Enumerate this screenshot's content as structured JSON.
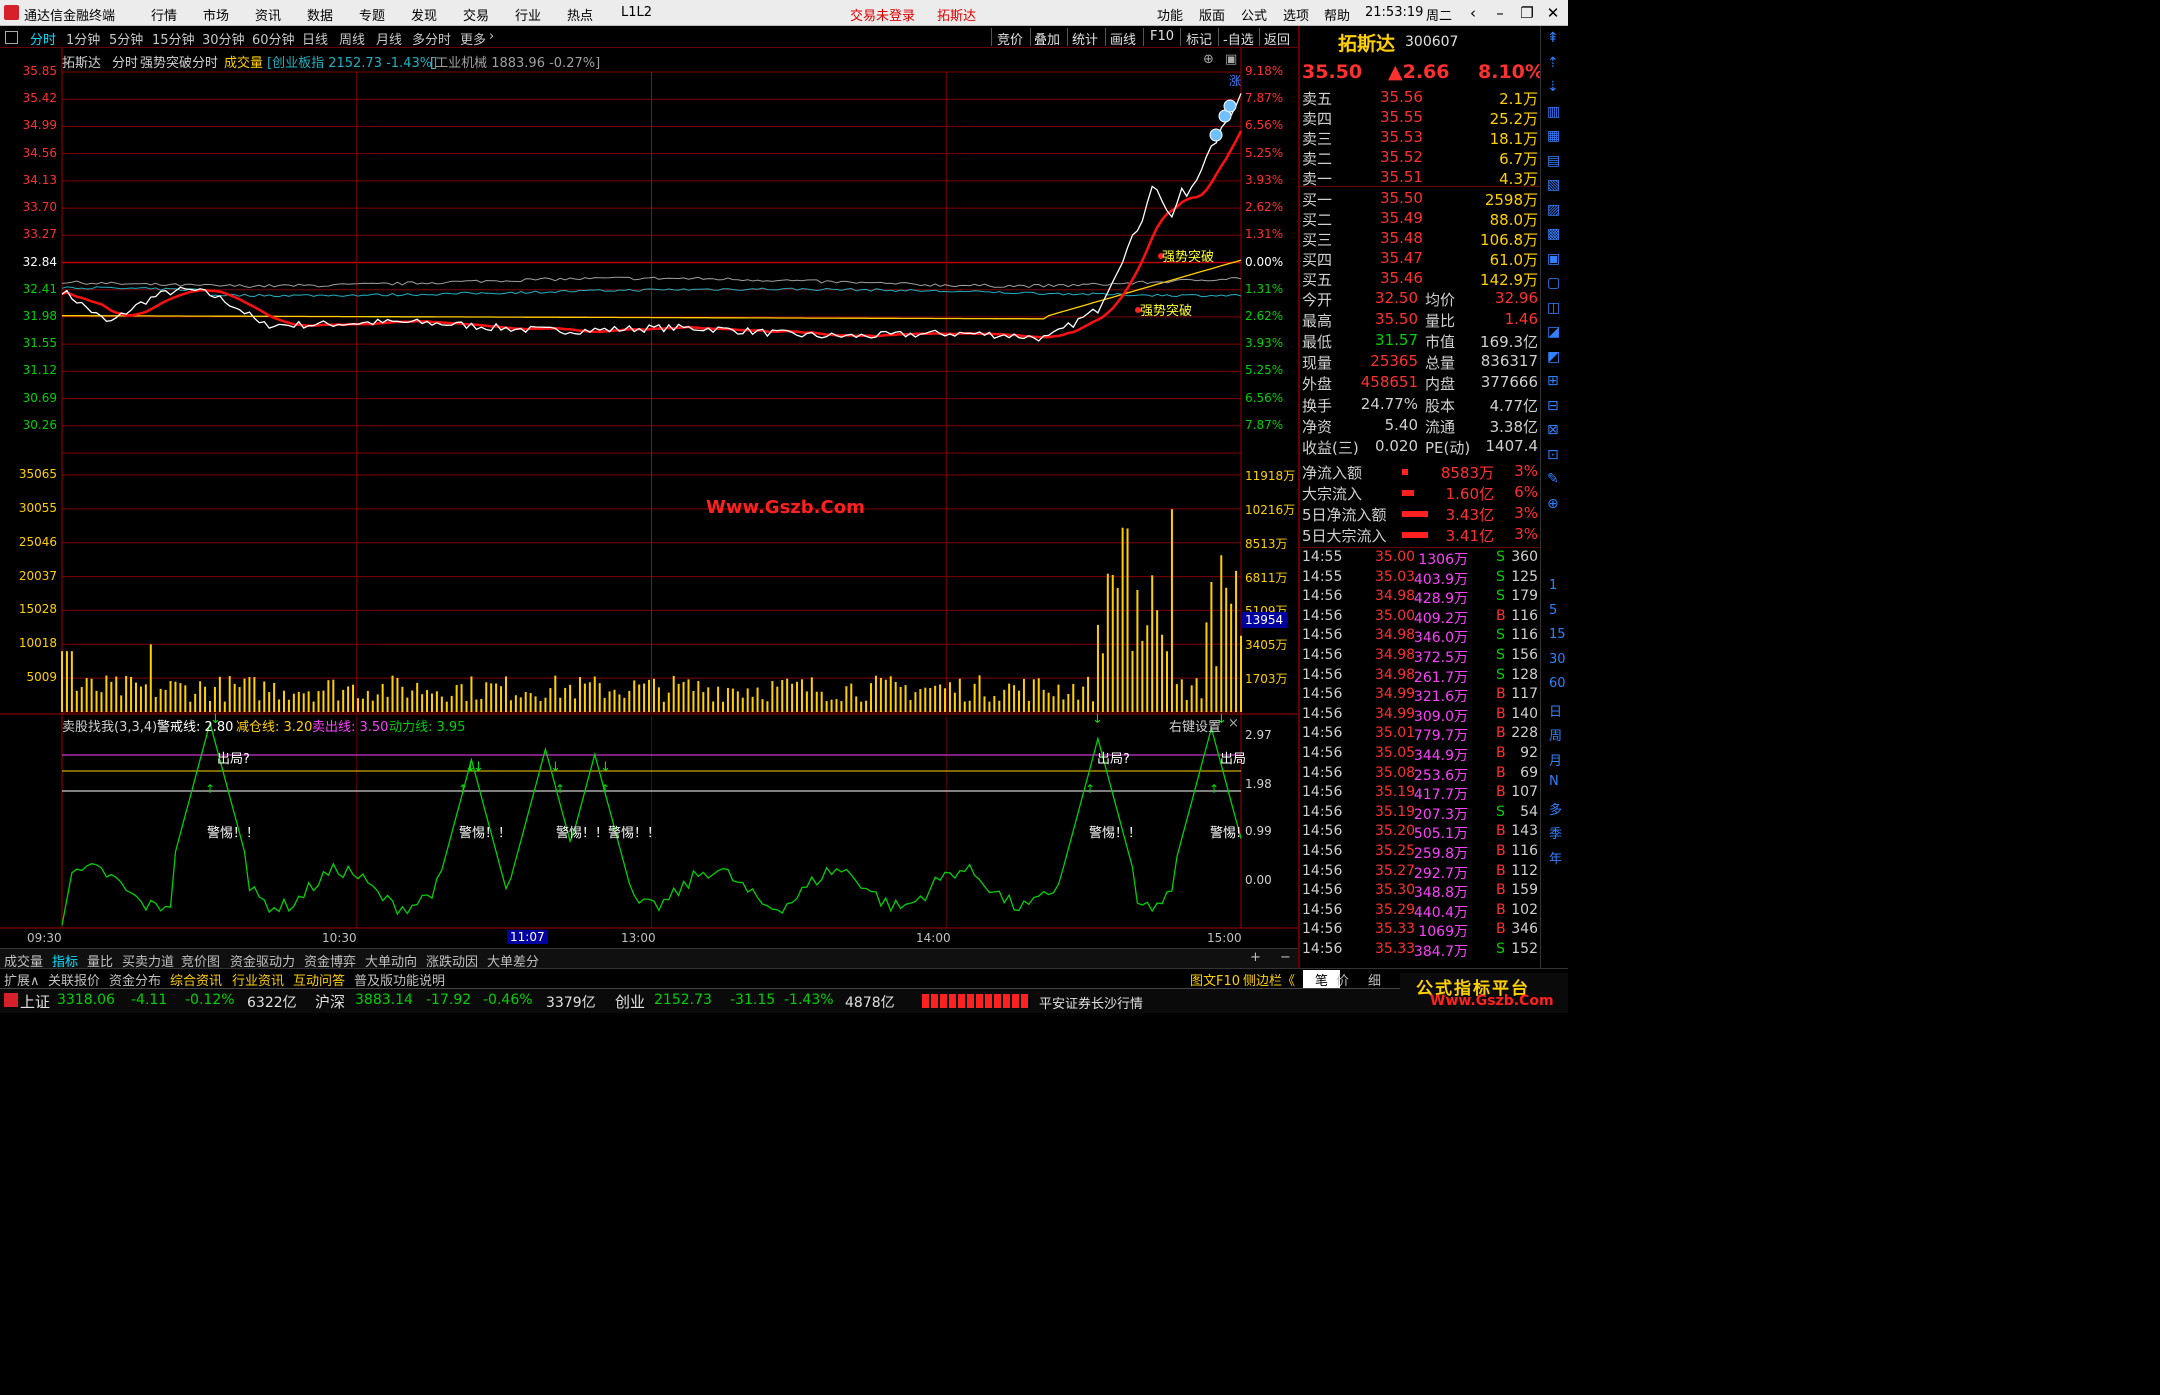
{
  "menubar": {
    "app_title": "通达信金融终端",
    "menus": [
      "行情",
      "市场",
      "资讯",
      "数据",
      "专题",
      "发现",
      "交易",
      "行业",
      "热点",
      "L1L2"
    ],
    "login": "交易未登录",
    "stock_hint": "拓斯达",
    "right_menus": [
      "功能",
      "版面",
      "公式",
      "选项",
      "帮助"
    ],
    "time": "21:53:19",
    "weekday": "周二"
  },
  "periods": [
    "分时",
    "1分钟",
    "5分钟",
    "15分钟",
    "30分钟",
    "60分钟",
    "日线",
    "周线",
    "月线",
    "多分时",
    "更多"
  ],
  "active_period": "分时",
  "right_tools": [
    "竞价",
    "叠加",
    "统计",
    "画线",
    "F10",
    "标记",
    "-自选",
    "返回"
  ],
  "header": {
    "name": "拓斯达",
    "mode": "分时",
    "formula": "强势突破分时",
    "vol_label": "成交量",
    "idx1": "[创业板指 2152.73 -1.43%]",
    "idx2": "[工业机械 1883.96 -0.27%]"
  },
  "price_axis_left": [
    "35.85",
    "35.42",
    "34.99",
    "34.56",
    "34.13",
    "33.70",
    "33.27",
    "32.84",
    "32.41",
    "31.98",
    "31.55",
    "31.12",
    "30.69",
    "30.26"
  ],
  "price_axis_right": [
    "9.18%",
    "7.87%",
    "6.56%",
    "5.25%",
    "3.93%",
    "2.62%",
    "1.31%",
    "0.00%",
    "1.31%",
    "2.62%",
    "3.93%",
    "5.25%",
    "6.56%",
    "7.87%"
  ],
  "vol_axis_left": [
    "35065",
    "30055",
    "25046",
    "20037",
    "15028",
    "10018",
    "5009"
  ],
  "vol_axis_right": [
    "11918万",
    "10216万",
    "8513万",
    "6811万",
    "5109万",
    "3405万",
    "1703万"
  ],
  "vol_cursor": "13954",
  "watermark": "Www.Gszb.Com",
  "annot": {
    "breakout1": "强势突破",
    "breakout2": "强势突破"
  },
  "ind": {
    "name": "卖股找我(3,3,4)",
    "warn": "警戒线: 2.80",
    "reduce": "减仓线: 3.20",
    "sell": "卖出线: 3.50",
    "power": "动力线: 3.95",
    "settings": "右键设置",
    "axis": [
      "2.97",
      "1.98",
      "0.99",
      "0.00"
    ],
    "tag_out": "出局?",
    "tag_warn": "警惕！！",
    "tag_warn2": "警惕！！警惕！！",
    "tag_warn3": "警惕!",
    "tag_out2": "出局"
  },
  "time_axis": [
    "09:30",
    "10:30",
    "11:07",
    "13:00",
    "14:00",
    "15:00"
  ],
  "tabs": [
    "成交量",
    "指标",
    "量比",
    "买卖力道",
    "竞价图",
    "资金驱动力",
    "资金博弈",
    "大单动向",
    "涨跌动因",
    "大单差分"
  ],
  "tabs2": [
    "扩展∧",
    "关联报价",
    "资金分布",
    "综合资讯",
    "行业资讯",
    "互动问答",
    "普及版功能说明"
  ],
  "right_panel": {
    "name": "拓斯达",
    "code": "300607",
    "price": "35.50",
    "change": "▲2.66",
    "pct": "8.10%",
    "asks": [
      [
        "卖五",
        "35.56",
        "2.1万"
      ],
      [
        "卖四",
        "35.55",
        "25.2万"
      ],
      [
        "卖三",
        "35.53",
        "18.1万"
      ],
      [
        "卖二",
        "35.52",
        "6.7万"
      ],
      [
        "卖一",
        "35.51",
        "4.3万"
      ]
    ],
    "bids": [
      [
        "买一",
        "35.50",
        "2598万"
      ],
      [
        "买二",
        "35.49",
        "88.0万"
      ],
      [
        "买三",
        "35.48",
        "106.8万"
      ],
      [
        "买四",
        "35.47",
        "61.0万"
      ],
      [
        "买五",
        "35.46",
        "142.9万"
      ]
    ],
    "stats": [
      [
        "今开",
        "32.50",
        "均价",
        "32.96"
      ],
      [
        "最高",
        "35.50",
        "量比",
        "1.46"
      ],
      [
        "最低",
        "31.57",
        "市值",
        "169.3亿"
      ],
      [
        "现量",
        "25365",
        "总量",
        "836317"
      ],
      [
        "外盘",
        "458651",
        "内盘",
        "377666"
      ]
    ],
    "stats2": [
      [
        "换手",
        "24.77%",
        "股本",
        "4.77亿"
      ],
      [
        "净资",
        "5.40",
        "流通",
        "3.38亿"
      ],
      [
        "收益(三)",
        "0.020",
        "PE(动)",
        "1407.4"
      ]
    ],
    "flow": [
      [
        "净流入额",
        "8583万",
        "3%"
      ],
      [
        "大宗流入",
        "1.60亿",
        "6%"
      ],
      [
        "5日净流入额",
        "3.43亿",
        "3%"
      ],
      [
        "5日大宗流入",
        "3.41亿",
        "3%"
      ]
    ],
    "ticks": [
      [
        "14:55",
        "35.00",
        "1306万",
        "S",
        "360"
      ],
      [
        "14:55",
        "35.03",
        "403.9万",
        "S",
        "125"
      ],
      [
        "14:56",
        "34.98",
        "428.9万",
        "S",
        "179"
      ],
      [
        "14:56",
        "35.00",
        "409.2万",
        "B",
        "116"
      ],
      [
        "14:56",
        "34.98",
        "346.0万",
        "S",
        "116"
      ],
      [
        "14:56",
        "34.98",
        "372.5万",
        "S",
        "156"
      ],
      [
        "14:56",
        "34.98",
        "261.7万",
        "S",
        "128"
      ],
      [
        "14:56",
        "34.99",
        "321.6万",
        "B",
        "117"
      ],
      [
        "14:56",
        "34.99",
        "309.0万",
        "B",
        "140"
      ],
      [
        "14:56",
        "35.01",
        "779.7万",
        "B",
        "228"
      ],
      [
        "14:56",
        "35.05",
        "344.9万",
        "B",
        "92"
      ],
      [
        "14:56",
        "35.08",
        "253.6万",
        "B",
        "69"
      ],
      [
        "14:56",
        "35.19",
        "417.7万",
        "B",
        "107"
      ],
      [
        "14:56",
        "35.19",
        "207.3万",
        "S",
        "54"
      ],
      [
        "14:56",
        "35.20",
        "505.1万",
        "B",
        "143"
      ],
      [
        "14:56",
        "35.25",
        "259.8万",
        "B",
        "116"
      ],
      [
        "14:56",
        "35.27",
        "292.7万",
        "B",
        "112"
      ],
      [
        "14:56",
        "35.30",
        "348.8万",
        "B",
        "159"
      ],
      [
        "14:56",
        "35.29",
        "440.4万",
        "B",
        "102"
      ],
      [
        "14:56",
        "35.33",
        "1069万",
        "B",
        "346"
      ],
      [
        "14:56",
        "35.33",
        "384.7万",
        "S",
        "152"
      ]
    ],
    "bottom": [
      "图文F10",
      "侧边栏《",
      "笔",
      "价",
      "细"
    ]
  },
  "side_labels": [
    "1",
    "5",
    "15",
    "30",
    "60",
    "日",
    "周",
    "月",
    "N",
    "多",
    "季",
    "年"
  ],
  "status": {
    "sh_name": "上证",
    "sh_val": "3318.06",
    "sh_chg": "-4.11",
    "sh_pct": "-0.12%",
    "sh_amt": "6322亿",
    "sz_name": "沪深",
    "sz_val": "3883.14",
    "sz_chg": "-17.92",
    "sz_pct": "-0.46%",
    "sz_amt": "3379亿",
    "cy_name": "创业",
    "cy_val": "2152.73",
    "cy_chg": "-31.15",
    "cy_pct": "-1.43%",
    "cy_amt": "4878亿",
    "broker": "平安证券长沙行情",
    "brand": "公式指标平台",
    "brand_url": "Www.Gszb.Com"
  },
  "colors": {
    "up": "#ff3030",
    "down": "#00d000",
    "grid": "#a00000",
    "price_line": "#ffffff",
    "avg_line": "#ffd000",
    "ind_line": "#00d000",
    "accent": "#00e0ff"
  }
}
